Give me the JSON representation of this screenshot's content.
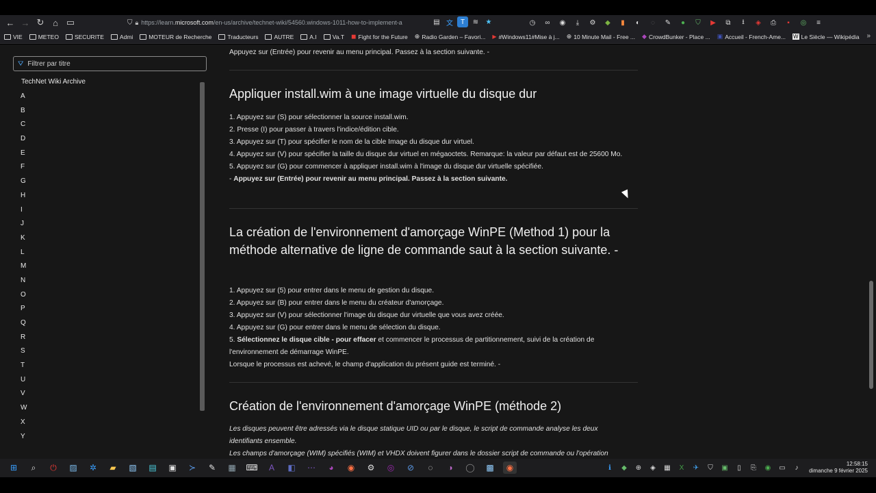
{
  "browser": {
    "url_prefix": "https://learn.",
    "url_domain": "microsoft.com",
    "url_rest": "/en-us/archive/technet-wiki/54560.windows-1011-how-to-implement-a",
    "bookmarks": [
      {
        "label": "VIE",
        "icon": "folder-icon"
      },
      {
        "label": "METEO",
        "icon": "folder-icon"
      },
      {
        "label": "SECURITE",
        "icon": "folder-icon"
      },
      {
        "label": "Admi",
        "icon": "folder-icon"
      },
      {
        "label": "MOTEUR de Recherche",
        "icon": "folder-icon"
      },
      {
        "label": "Traducteurs",
        "icon": "folder-icon"
      },
      {
        "label": "AUTRE",
        "icon": "folder-icon"
      },
      {
        "label": "A.I",
        "icon": "folder-icon"
      },
      {
        "label": "Va.T",
        "icon": "folder-icon"
      },
      {
        "label": "Fight for the Future",
        "icon": "site-icon"
      },
      {
        "label": "Radio Garden – Favori...",
        "icon": "globe-icon"
      },
      {
        "label": "#Windows11#Mise à j...",
        "icon": "youtube-icon"
      },
      {
        "label": "10 Minute Mail - Free ...",
        "icon": "globe-icon"
      },
      {
        "label": "CrowdBunker - Place ...",
        "icon": "site-icon"
      },
      {
        "label": "Accueil - French-Ame...",
        "icon": "site-icon"
      },
      {
        "label": "Le Siècle — Wikipédia",
        "icon": "wikipedia-icon"
      }
    ]
  },
  "sidebar": {
    "filter_placeholder": "Filtrer par titre",
    "title": "TechNet Wiki Archive",
    "letters": [
      "A",
      "B",
      "C",
      "D",
      "E",
      "F",
      "G",
      "H",
      "I",
      "J",
      "K",
      "L",
      "M",
      "N",
      "O",
      "P",
      "Q",
      "R",
      "S",
      "T",
      "U",
      "V",
      "W",
      "X",
      "Y"
    ]
  },
  "article": {
    "top_line": "Appuyez sur (Entrée) pour revenir au menu principal. Passez à la section suivante. -",
    "section1": {
      "heading": "Appliquer install.wim à une image virtuelle du disque dur",
      "lines": [
        "1. Appuyez sur (S) pour sélectionner la source install.wim.",
        "2. Presse (I) pour passer à travers l'indice/édition cible.",
        "3. Appuyez sur (T) pour spécifier le nom de la cible Image du disque dur virtuel.",
        "4. Appuyez sur (V) pour spécifier la taille du disque dur virtuel en mégaoctets. Remarque: la valeur par défaut est de 25600 Mo.",
        "5. Appuyez sur (G) pour commencer à appliquer install.wim à l'image du disque dur virtuelle spécifiée."
      ],
      "dash": "- ",
      "bold_line": "Appuyez sur (Entrée) pour revenir au menu principal. Passez à la section suivante."
    },
    "section2": {
      "heading": "La création de l'environnement d'amorçage WinPE (Method 1) pour la méthode alternative de ligne de commande saut à la section suivante. -",
      "lines": [
        "1. Appuyez sur (5) pour entrer dans le menu de gestion du disque.",
        "2. Appuyez sur (B) pour entrer dans le menu du créateur d'amorçage.",
        "3. Appuyez sur (V) pour sélectionner l'image du disque dur virtuelle que vous avez créée.",
        "4. Appuyez sur (G) pour entrer dans le menu de sélection du disque."
      ],
      "line5_prefix": "5. ",
      "line5_bold": "Sélectionnez le disque cible - pour effacer",
      "line5_rest": " et commencer le processus de partitionnement, suivi de la création de l'environnement de démarrage WinPE.",
      "final": "Lorsque le processus est achevé, le champ d'application du présent guide est terminé. -"
    },
    "section3": {
      "heading": "Création de l'environnement d'amorçage WinPE (méthode 2)",
      "italic1": "Les disques peuvent être adressés via le disque statique UID ou par le disque, le script de commande analyse les deux identifiants ensemble.",
      "italic2": "Les champs d'amorçage (WIM) spécifiés (WIM) et VHDX doivent figurer dans le dossier script de commande ou l'opération"
    }
  },
  "taskbar": {
    "time": "12:58:15",
    "date": "dimanche 9 février 2025"
  }
}
